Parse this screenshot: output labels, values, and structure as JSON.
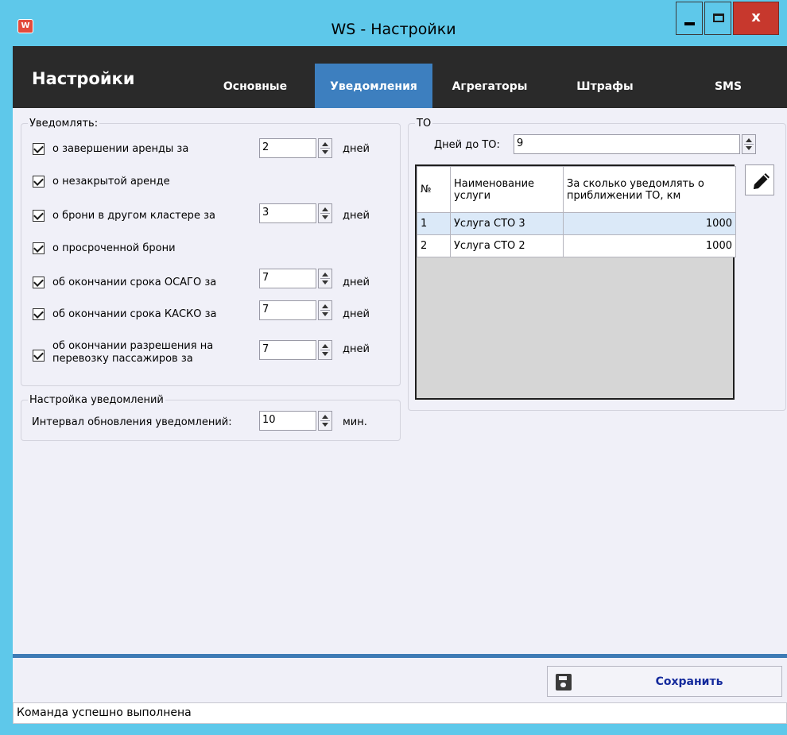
{
  "window": {
    "icon_letter": "W",
    "title": "WS - Настройки",
    "close_label": "x"
  },
  "header": {
    "title": "Настройки",
    "tabs": [
      {
        "label": "Основные",
        "active": false
      },
      {
        "label": "Уведомления",
        "active": true
      },
      {
        "label": "Агрегаторы",
        "active": false
      },
      {
        "label": "Штрафы",
        "active": false
      },
      {
        "label": "SMS",
        "active": false
      }
    ]
  },
  "notify": {
    "legend": "Уведомлять:",
    "items": [
      {
        "label": "о завершении аренды за",
        "checked": true,
        "value": "2",
        "unit": "дней"
      },
      {
        "label": "о незакрытой аренде",
        "checked": true
      },
      {
        "label": "о брони в другом кластере за",
        "checked": true,
        "value": "3",
        "unit": "дней"
      },
      {
        "label": "о просроченной брони",
        "checked": true
      },
      {
        "label": "об окончании срока ОСАГО за",
        "checked": true,
        "value": "7",
        "unit": "дней"
      },
      {
        "label": "об окончании срока КАСКО за",
        "checked": true,
        "value": "7",
        "unit": "дней"
      },
      {
        "label_line1": "об окончании разрешения на",
        "label_line2": "перевозку пассажиров за",
        "checked": true,
        "value": "7",
        "unit": "дней"
      }
    ]
  },
  "settings": {
    "legend": "Настройка уведомлений",
    "interval_label": "Интервал обновления уведомлений:",
    "interval_value": "10",
    "interval_unit": "мин."
  },
  "to": {
    "legend": "ТО",
    "days_label": "Дней до ТО:",
    "days_value": "9",
    "columns": [
      "№",
      "Наименование услуги",
      "За сколько уведомлять о приближении ТО, км"
    ],
    "rows": [
      {
        "n": "1",
        "name": "Услуга СТО 3",
        "km": "1000",
        "selected": true
      },
      {
        "n": "2",
        "name": "Услуга СТО 2",
        "km": "1000",
        "selected": false
      }
    ]
  },
  "footer": {
    "save_label": "Сохранить",
    "status": "Команда успешно выполнена"
  }
}
